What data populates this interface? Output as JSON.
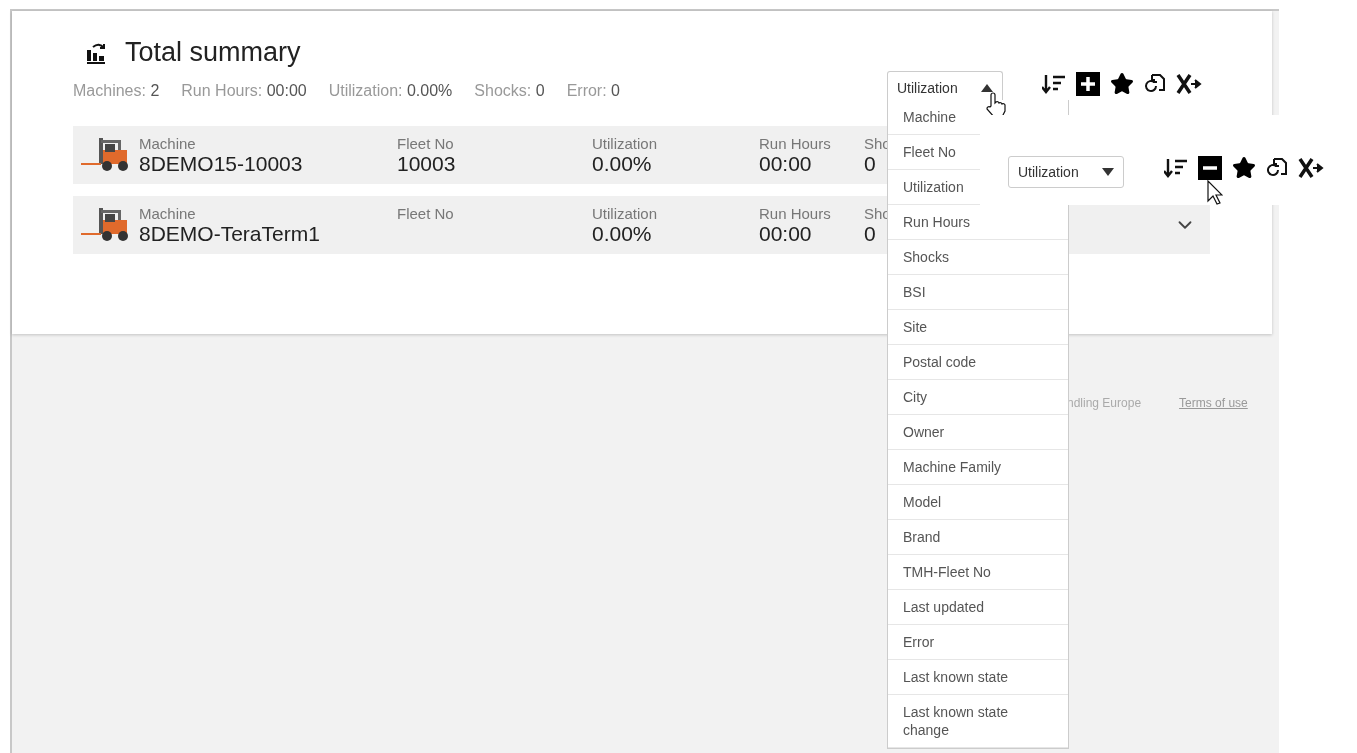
{
  "header": {
    "title": "Total summary"
  },
  "stats": [
    {
      "label": "Machines:",
      "value": "2"
    },
    {
      "label": "Run Hours:",
      "value": "00:00"
    },
    {
      "label": "Utilization:",
      "value": "0.00%"
    },
    {
      "label": "Shocks:",
      "value": "0"
    },
    {
      "label": "Error:",
      "value": "0"
    }
  ],
  "toolbars": [
    {
      "select": "Utilization",
      "open": true,
      "all_expanded": false
    },
    {
      "select": "Utilization",
      "open": false,
      "all_expanded": true
    }
  ],
  "rows": [
    {
      "cells": [
        {
          "label": "Machine",
          "value": "8DEMO15-10003"
        },
        {
          "label": "Fleet No",
          "value": "10003"
        },
        {
          "label": "Utilization",
          "value": "0.00%"
        },
        {
          "label": "Run Hours",
          "value": "00:00"
        },
        {
          "label": "Sho",
          "value": "0"
        }
      ]
    },
    {
      "cells": [
        {
          "label": "Machine",
          "value": "8DEMO-TeraTerm1"
        },
        {
          "label": "Fleet No"
        },
        {
          "label": "Utilization",
          "value": "0.00%"
        },
        {
          "label": "Run Hours",
          "value": "00:00"
        },
        {
          "label": "Sho",
          "value": "0"
        }
      ]
    }
  ],
  "menu": {
    "items": [
      "Machine",
      "Fleet No",
      "Utilization",
      "Run Hours",
      "Shocks",
      "BSI",
      "Site",
      "Postal code",
      "City",
      "Owner",
      "Machine Family",
      "Model",
      "Brand",
      "TMH-Fleet No",
      "Last updated",
      "Error",
      "Last known state",
      "Last known state change"
    ]
  },
  "footer": {
    "company": "ndling Europe",
    "terms": "Terms of use"
  }
}
